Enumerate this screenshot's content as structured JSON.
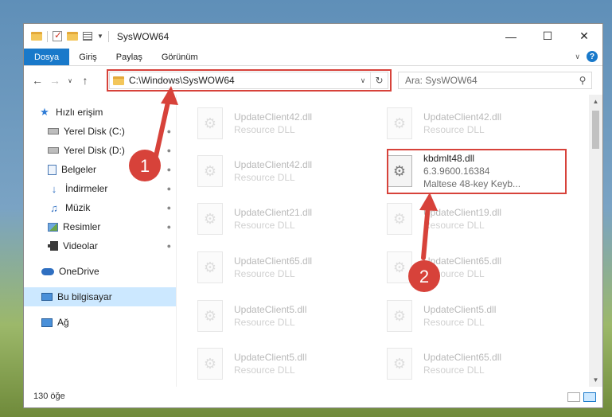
{
  "window": {
    "title": "SysWOW64"
  },
  "ribbon": {
    "tabs": [
      "Dosya",
      "Giriş",
      "Paylaş",
      "Görünüm"
    ]
  },
  "address": {
    "path": "C:\\Windows\\SysWOW64"
  },
  "search": {
    "placeholder": "Ara: SysWOW64"
  },
  "sidebar": {
    "quick_access": "Hızlı erişim",
    "items": [
      {
        "label": "Yerel Disk (C:)",
        "icon": "drive-icon"
      },
      {
        "label": "Yerel Disk (D:)",
        "icon": "drive-icon"
      },
      {
        "label": "Belgeler",
        "icon": "documents-icon"
      },
      {
        "label": "İndirmeler",
        "icon": "downloads-icon"
      },
      {
        "label": "Müzik",
        "icon": "music-icon"
      },
      {
        "label": "Resimler",
        "icon": "pictures-icon"
      },
      {
        "label": "Videolar",
        "icon": "videos-icon"
      }
    ],
    "onedrive": "OneDrive",
    "this_pc": "Bu bilgisayar",
    "network": "Ağ"
  },
  "files": [
    {
      "name": "UpdateClient42.dll",
      "sub": "Resource DLL"
    },
    {
      "name": "UpdateClient42.dll",
      "sub": "Resource DLL"
    },
    {
      "name": "UpdateClient42.dll",
      "sub": "Resource DLL"
    },
    {
      "name": "kbdmlt48.dll",
      "sub": "6.3.9600.16384",
      "sub2": "Maltese 48-key Keyb..."
    },
    {
      "name": "UpdateClient21.dll",
      "sub": "Resource DLL"
    },
    {
      "name": "UpdateClient19.dll",
      "sub": "Resource DLL"
    },
    {
      "name": "UpdateClient65.dll",
      "sub": "Resource DLL"
    },
    {
      "name": "UpdateClient65.dll",
      "sub": "Resource DLL"
    },
    {
      "name": "UpdateClient5.dll",
      "sub": "Resource DLL"
    },
    {
      "name": "UpdateClient5.dll",
      "sub": "Resource DLL"
    },
    {
      "name": "UpdateClient5.dll",
      "sub": "Resource DLL"
    },
    {
      "name": "UpdateClient65.dll",
      "sub": "Resource DLL"
    }
  ],
  "status": {
    "count": "130 öğe"
  },
  "annotations": {
    "step1": "1",
    "step2": "2",
    "color": "#d7423a"
  }
}
